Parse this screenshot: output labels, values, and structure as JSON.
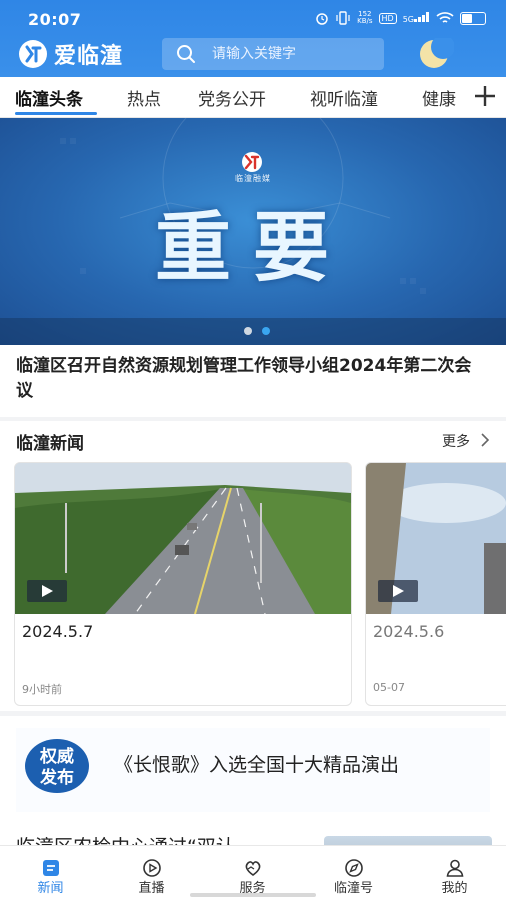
{
  "status_bar": {
    "time": "20:07",
    "net_speed_value": "152",
    "net_speed_unit": "KB/s",
    "hd": "HD",
    "network": "5G"
  },
  "header": {
    "app_name": "爱临潼",
    "search_placeholder": "请输入关键字"
  },
  "tabs": [
    {
      "label": "临潼头条",
      "active": true
    },
    {
      "label": "热点"
    },
    {
      "label": "党务公开"
    },
    {
      "label": "视听临潼"
    },
    {
      "label": "健康"
    }
  ],
  "banner": {
    "org_text": "临潼融媒",
    "title": "重要",
    "headline": "临潼区召开自然资源规划管理工作领导小组2024年第二次会议",
    "slide_count": 2,
    "active_slide": 2
  },
  "news": {
    "section_title": "临潼新闻",
    "more_label": "更多",
    "items": [
      {
        "title": "2024.5.7",
        "time": "9小时前"
      },
      {
        "title": "2024.5.6",
        "time": "05-07"
      }
    ]
  },
  "promo": {
    "badge_line1": "权威",
    "badge_line2": "发布",
    "text": "《长恨歌》入选全国十大精品演出"
  },
  "next_article": {
    "title": "临潼区农检中心通过“双认"
  },
  "bottom_nav": [
    {
      "label": "新闻",
      "icon": "news-icon",
      "active": true
    },
    {
      "label": "直播",
      "icon": "live-icon"
    },
    {
      "label": "服务",
      "icon": "service-icon"
    },
    {
      "label": "临潼号",
      "icon": "compass-icon"
    },
    {
      "label": "我的",
      "icon": "profile-icon"
    }
  ],
  "colors": {
    "brand": "#2f86e6",
    "banner": "#2767b0",
    "active_dot": "#3aa6f0"
  }
}
